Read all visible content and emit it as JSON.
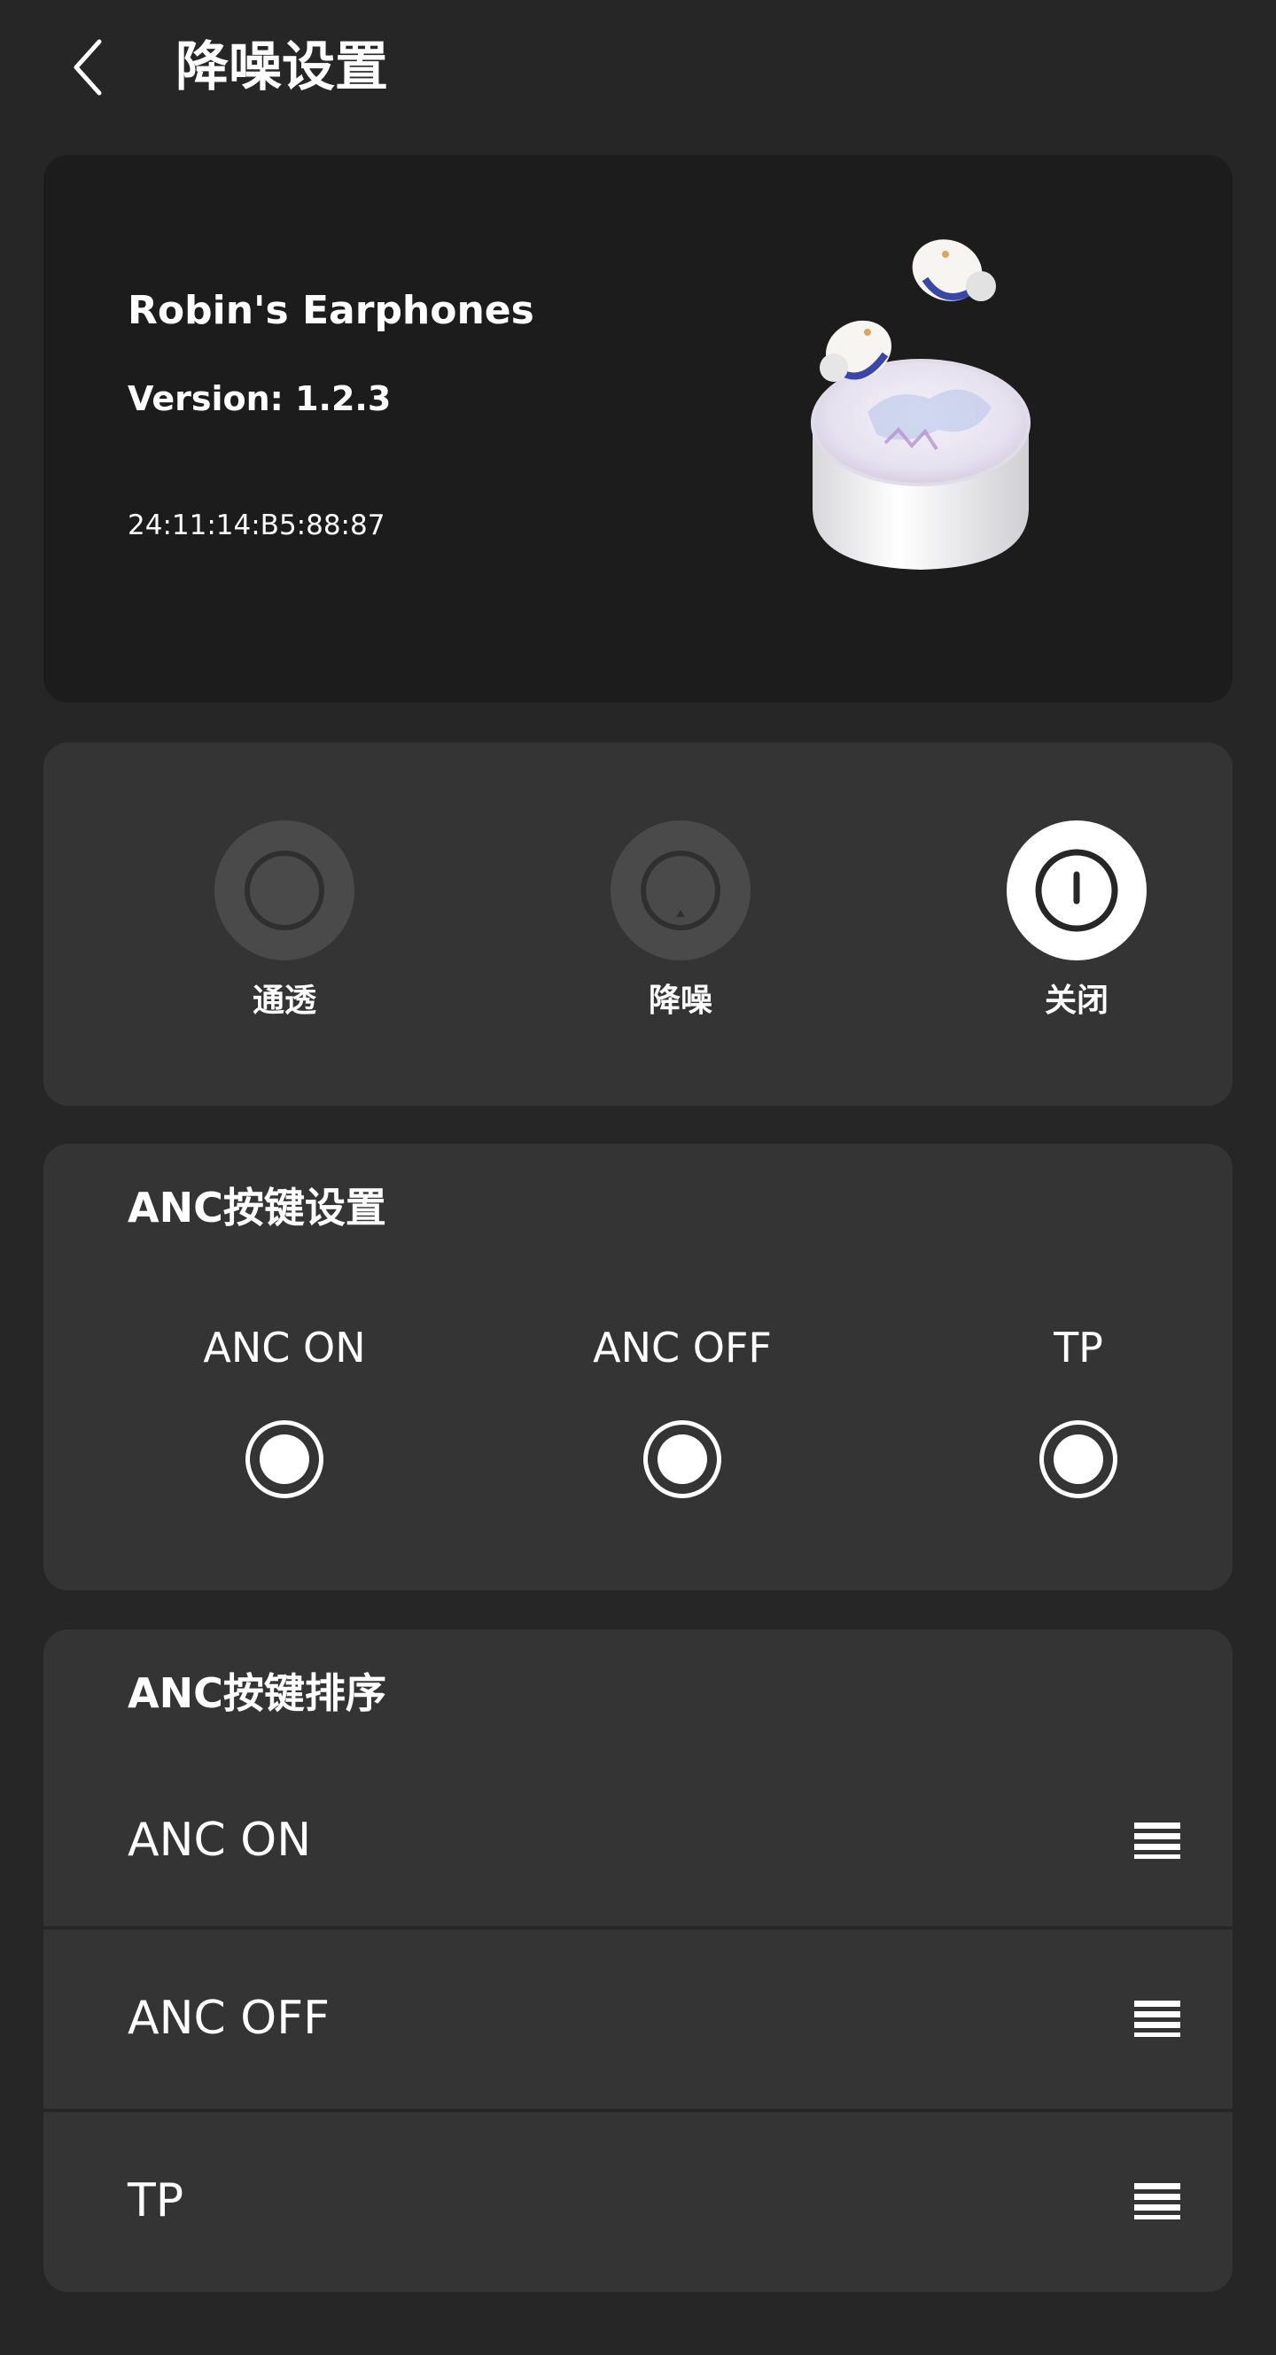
{
  "header": {
    "title": "降噪设置",
    "back_icon": "chevron-left-icon"
  },
  "device": {
    "name": "Robin's Earphones",
    "version": "Version: 1.2.3",
    "mac": "24:11:14:B5:88:87",
    "image": "earphones-case-image"
  },
  "modes": {
    "items": [
      {
        "label": "通透",
        "icon": "transparency-icon",
        "active": false
      },
      {
        "label": "降噪",
        "icon": "noise-cancel-icon",
        "active": false
      },
      {
        "label": "关闭",
        "icon": "power-icon",
        "active": true
      }
    ]
  },
  "anc_keys": {
    "title": "ANC按键设置",
    "options": [
      {
        "label": "ANC ON",
        "checked": true
      },
      {
        "label": "ANC OFF",
        "checked": true
      },
      {
        "label": "TP",
        "checked": true
      }
    ]
  },
  "anc_order": {
    "title": "ANC按键排序",
    "items": [
      {
        "label": "ANC ON",
        "icon": "drag-handle-icon"
      },
      {
        "label": "ANC OFF",
        "icon": "drag-handle-icon"
      },
      {
        "label": "TP",
        "icon": "drag-handle-icon"
      }
    ]
  },
  "colors": {
    "background": "#262626",
    "device_card": "#1c1c1d",
    "card": "#343434",
    "mode_inactive": "#4a4a4a",
    "mode_active": "#ffffff"
  }
}
